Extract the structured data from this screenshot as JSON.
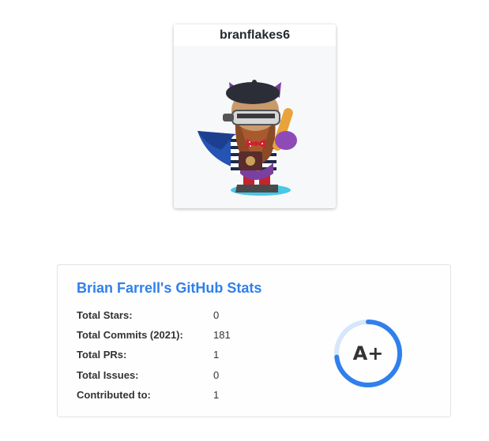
{
  "profile": {
    "username": "branflakes6",
    "avatar_icon": "octocat-avatar-icon"
  },
  "stats": {
    "title": "Brian Farrell's GitHub Stats",
    "rows": [
      {
        "label": "Total Stars:",
        "value": "0"
      },
      {
        "label": "Total Commits (2021):",
        "value": "181"
      },
      {
        "label": "Total PRs:",
        "value": "1"
      },
      {
        "label": "Total Issues:",
        "value": "0"
      },
      {
        "label": "Contributed to:",
        "value": "1"
      }
    ],
    "rank": {
      "grade": "A+",
      "progress": 0.73
    },
    "colors": {
      "title": "#2f80ed",
      "ring": "#2f80ed",
      "text": "#333333"
    }
  }
}
